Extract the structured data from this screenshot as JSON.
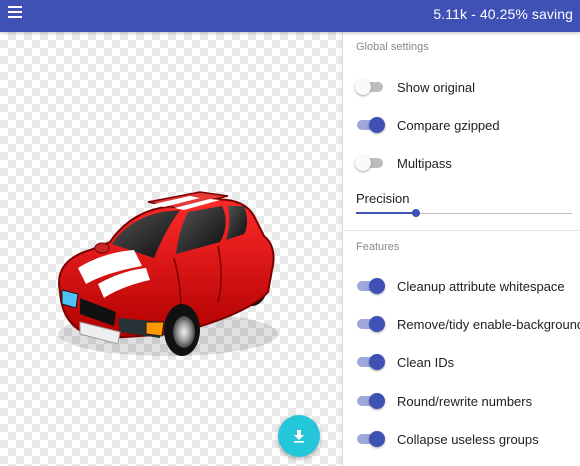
{
  "header": {
    "status": "5.11k - 40.25% saving"
  },
  "preview": {
    "image_subject": "red cartoon car",
    "download_icon": "download-icon"
  },
  "global_settings": {
    "title": "Global settings",
    "toggles": [
      {
        "label": "Show original",
        "on": false
      },
      {
        "label": "Compare gzipped",
        "on": true
      },
      {
        "label": "Multipass",
        "on": false
      }
    ],
    "precision": {
      "label": "Precision",
      "fraction": 0.28
    }
  },
  "features": {
    "title": "Features",
    "toggles": [
      {
        "label": "Cleanup attribute whitespace",
        "on": true
      },
      {
        "label": "Remove/tidy enable-background",
        "on": true
      },
      {
        "label": "Clean IDs",
        "on": true
      },
      {
        "label": "Round/rewrite numbers",
        "on": true
      },
      {
        "label": "Collapse useless groups",
        "on": true
      }
    ]
  },
  "colors": {
    "primary": "#3f51b5",
    "accent": "#26c6da"
  }
}
